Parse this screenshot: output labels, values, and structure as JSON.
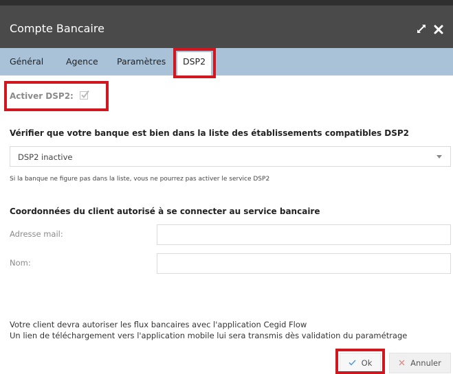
{
  "window": {
    "title": "Compte Bancaire",
    "expand_icon": "expand-arrows-icon",
    "close_icon": "close-icon"
  },
  "tabs": [
    {
      "label": "Général"
    },
    {
      "label": "Agence"
    },
    {
      "label": "Paramètres"
    },
    {
      "label": "DSP2",
      "active": true
    }
  ],
  "activer": {
    "label": "Activer DSP2:",
    "checked": true
  },
  "bank_section": {
    "title": "Vérifier que votre banque est bien dans la liste des établissements compatibles DSP2",
    "select_value": "DSP2 inactive",
    "hint": "Si la banque ne figure pas dans la liste, vous ne pourrez pas activer le service DSP2"
  },
  "client_section": {
    "title": "Coordonnées du client autorisé à se connecter au service bancaire",
    "email_label": "Adresse mail:",
    "email_value": "",
    "name_label": "Nom:",
    "name_value": ""
  },
  "footer": {
    "line1": "Votre client devra autoriser les flux bancaires avec l'application Cegid Flow",
    "line2": "Un lien de téléchargement vers l'application mobile lui sera transmis dès validation du paramétrage"
  },
  "buttons": {
    "ok_label": "Ok",
    "cancel_label": "Annuler"
  },
  "colors": {
    "titlebar": "#4a4a4a",
    "tabbar": "#a9c2d8",
    "highlight": "#d0161f",
    "ok_check": "#5b9bd5",
    "cancel_x": "#e08a8a"
  }
}
